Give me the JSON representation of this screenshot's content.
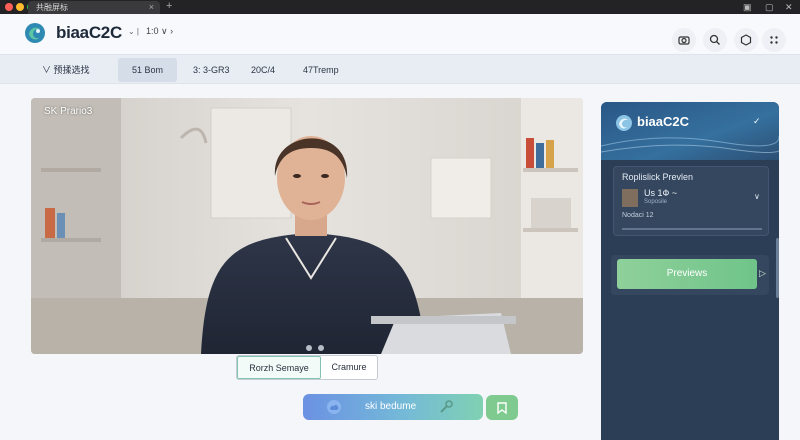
{
  "browser": {
    "tab_title": "共融屏标",
    "tab_close": "×",
    "new_tab": "+"
  },
  "header": {
    "brand": "biaaC2C",
    "brand_caret": "⌄ |",
    "zoom": "1:0  ∨ ›"
  },
  "tabs": [
    {
      "label": "∨    预揉选找"
    },
    {
      "label": "51 Bom"
    },
    {
      "label": "3:  3-GR3"
    },
    {
      "label": "20C/4"
    },
    {
      "label": "47Tremp"
    }
  ],
  "video": {
    "label": "SK  Prario3"
  },
  "segmented": {
    "left": "Rorzh  Semaye",
    "right": "Cramure"
  },
  "action": {
    "label": "ski bedume"
  },
  "panel": {
    "brand": "biaaC2C",
    "chev": "✓",
    "card": {
      "title": "Roplislick Prevlen",
      "name": "Us  1Ф ~",
      "sub": "Soposile",
      "meta": "Nodaci 12",
      "chev": "∨"
    },
    "preview_label": "Previews",
    "preview_arrow": "▷"
  },
  "colors": {
    "accent_blue": "#6b91e3",
    "accent_green": "#7fcb8f",
    "panel_bg": "#2c3e55"
  }
}
